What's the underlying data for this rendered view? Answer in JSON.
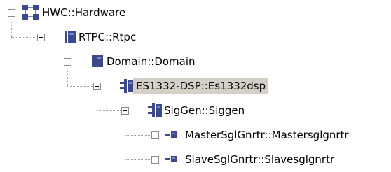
{
  "tree": {
    "nodes": [
      {
        "label": "HWC::Hardware",
        "icon": "hardware-group-icon",
        "expanded": true
      },
      {
        "label": "RTPC::Rtpc",
        "icon": "block-icon",
        "expanded": true
      },
      {
        "label": "Domain::Domain",
        "icon": "block-icon",
        "expanded": true
      },
      {
        "label": "ES1332-DSP::Es1332dsp",
        "icon": "component-icon",
        "expanded": true,
        "selected": true
      },
      {
        "label": "SigGen::Siggen",
        "icon": "component-icon",
        "expanded": true
      },
      {
        "label": "MasterSglGnrtr::Mastersglgnrtr",
        "icon": "leaf-component-icon",
        "expanded": false
      },
      {
        "label": "SlaveSglGnrtr::Slavesglgnrtr",
        "icon": "leaf-component-icon",
        "expanded": false
      }
    ]
  },
  "colors": {
    "icon_fill": "#3c4a8c",
    "icon_light": "#7a86c8",
    "selection": "#d4d0c8",
    "guide_lines": "#a0a0a0"
  }
}
